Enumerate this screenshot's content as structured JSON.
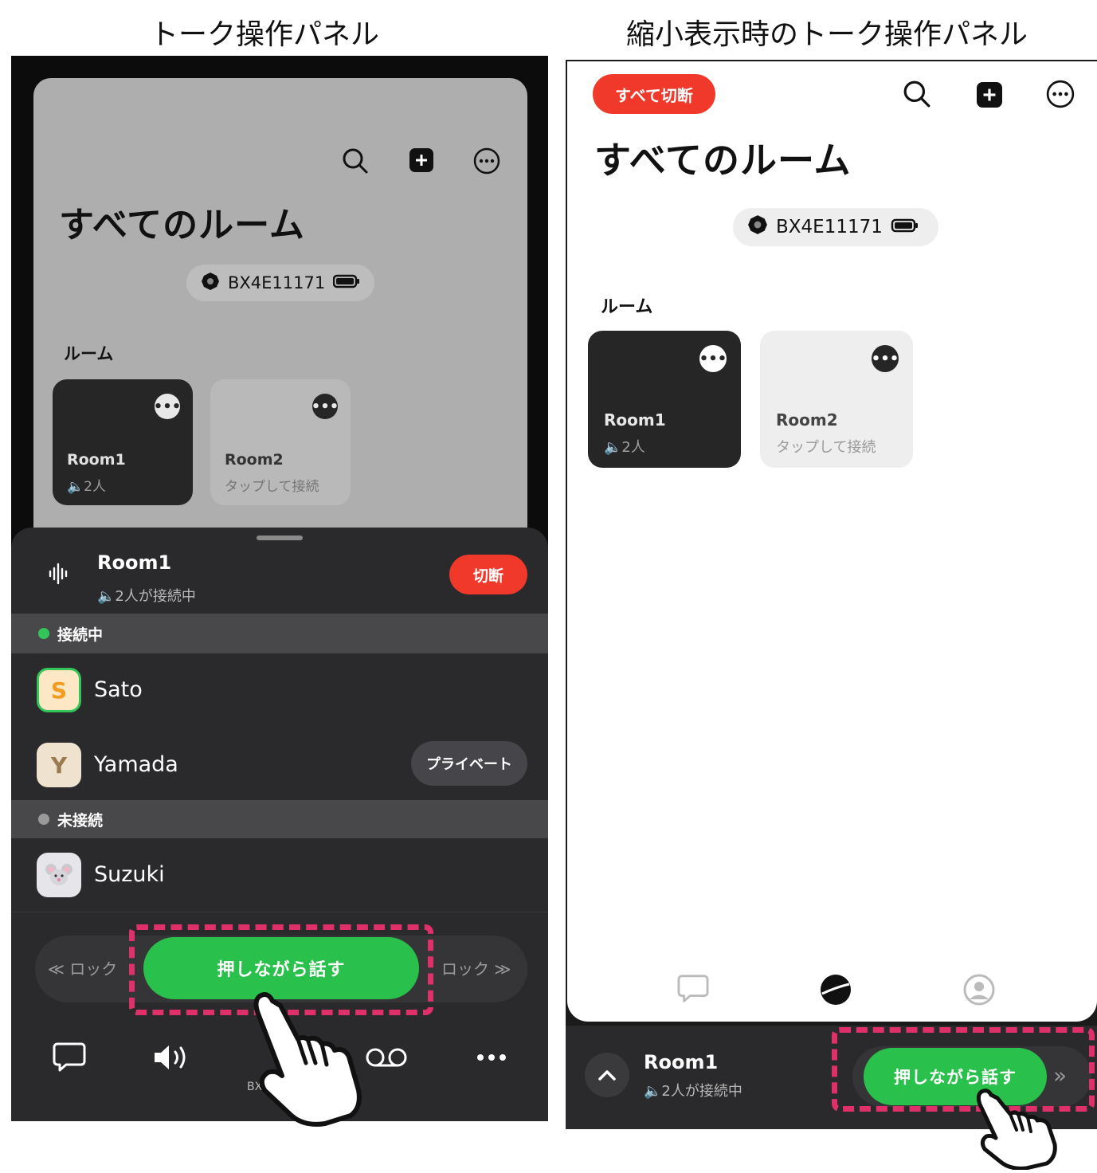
{
  "captions": {
    "left": "トーク操作パネル",
    "right": "縮小表示時のトーク操作パネル"
  },
  "home": {
    "title": "すべてのルーム",
    "device_name": "BX4E11171",
    "rooms_label": "ルーム",
    "rooms": [
      {
        "name": "Room1",
        "sub": "2人"
      },
      {
        "name": "Room2",
        "sub": "タップして接続"
      }
    ],
    "disconnect_all": "すべて切断"
  },
  "panel": {
    "room_name": "Room1",
    "status": "2人が接続中",
    "disconnect": "切断",
    "connected_label": "接続中",
    "not_connected_label": "未接続",
    "members_connected": [
      {
        "initial": "S",
        "name": "Sato"
      },
      {
        "initial": "Y",
        "name": "Yamada",
        "action": "プライベート"
      }
    ],
    "members_not_connected": [
      {
        "name": "Suzuki"
      }
    ],
    "lock_left": "≪ ロック",
    "lock_right": "ロック ≫",
    "ptt_label": "押しながら話す",
    "device_short": "BX4"
  },
  "mini": {
    "room_name": "Room1",
    "status": "2人が接続中",
    "ptt_label": "押しながら話す"
  },
  "colors": {
    "green": "#29c04c",
    "red": "#f0392b",
    "highlight": "#e0306a",
    "panel_bg": "#2a2a2c"
  }
}
